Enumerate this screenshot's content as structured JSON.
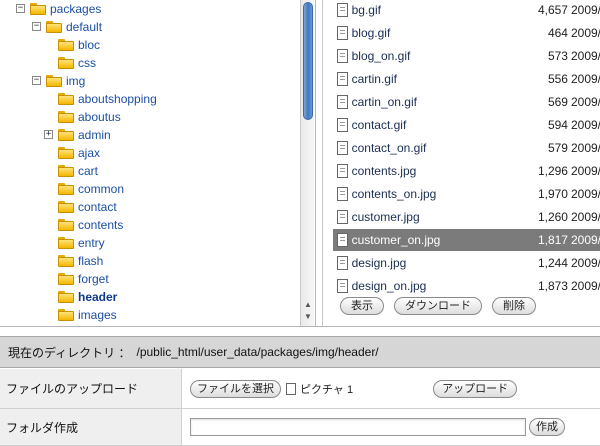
{
  "tree": {
    "items": [
      {
        "label": "packages",
        "toggle": "−",
        "current": false
      },
      {
        "label": "default",
        "toggle": "−",
        "current": false
      },
      {
        "label": "bloc",
        "toggle": "",
        "current": false
      },
      {
        "label": "css",
        "toggle": "",
        "current": false
      },
      {
        "label": "img",
        "toggle": "−",
        "current": false
      },
      {
        "label": "aboutshopping",
        "toggle": "",
        "current": false
      },
      {
        "label": "aboutus",
        "toggle": "",
        "current": false
      },
      {
        "label": "admin",
        "toggle": "+",
        "current": false
      },
      {
        "label": "ajax",
        "toggle": "",
        "current": false
      },
      {
        "label": "cart",
        "toggle": "",
        "current": false
      },
      {
        "label": "common",
        "toggle": "",
        "current": false
      },
      {
        "label": "contact",
        "toggle": "",
        "current": false
      },
      {
        "label": "contents",
        "toggle": "",
        "current": false
      },
      {
        "label": "entry",
        "toggle": "",
        "current": false
      },
      {
        "label": "flash",
        "toggle": "",
        "current": false
      },
      {
        "label": "forget",
        "toggle": "",
        "current": false
      },
      {
        "label": "header",
        "toggle": "",
        "current": true
      },
      {
        "label": "images",
        "toggle": "",
        "current": false
      }
    ]
  },
  "files": {
    "rows": [
      {
        "name": "bg.gif",
        "size": "4,657",
        "date": "2009/",
        "selected": false
      },
      {
        "name": "blog.gif",
        "size": "464",
        "date": "2009/",
        "selected": false
      },
      {
        "name": "blog_on.gif",
        "size": "573",
        "date": "2009/",
        "selected": false
      },
      {
        "name": "cartin.gif",
        "size": "556",
        "date": "2009/",
        "selected": false
      },
      {
        "name": "cartin_on.gif",
        "size": "569",
        "date": "2009/",
        "selected": false
      },
      {
        "name": "contact.gif",
        "size": "594",
        "date": "2009/",
        "selected": false
      },
      {
        "name": "contact_on.gif",
        "size": "579",
        "date": "2009/",
        "selected": false
      },
      {
        "name": "contents.jpg",
        "size": "1,296",
        "date": "2009/",
        "selected": false
      },
      {
        "name": "contents_on.jpg",
        "size": "1,970",
        "date": "2009/",
        "selected": false
      },
      {
        "name": "customer.jpg",
        "size": "1,260",
        "date": "2009/",
        "selected": false
      },
      {
        "name": "customer_on.jpg",
        "size": "1,817",
        "date": "2009/",
        "selected": true
      },
      {
        "name": "design.jpg",
        "size": "1,244",
        "date": "2009/",
        "selected": false
      },
      {
        "name": "design_on.jpg",
        "size": "1,873",
        "date": "2009/",
        "selected": false
      }
    ],
    "actions": {
      "view_label": "表示",
      "download_label": "ダウンロード",
      "delete_label": "削除"
    }
  },
  "current_dir": {
    "label": "現在のディレクトリ ：",
    "path": "/public_html/user_data/packages/img/header/"
  },
  "upload": {
    "label": "ファイルのアップロード",
    "choose_label": "ファイルを選択",
    "file_name": "ピクチャ 1",
    "upload_label": "アップロード"
  },
  "folder_create": {
    "label": "フォルダ作成",
    "input_value": "",
    "create_label": "作成"
  },
  "colors": {
    "link": "#1b4fa0",
    "selected_row": "#7b7b7b",
    "dir_bar": "#d6d6d6",
    "scroll_thumb": "#3f77bf"
  }
}
